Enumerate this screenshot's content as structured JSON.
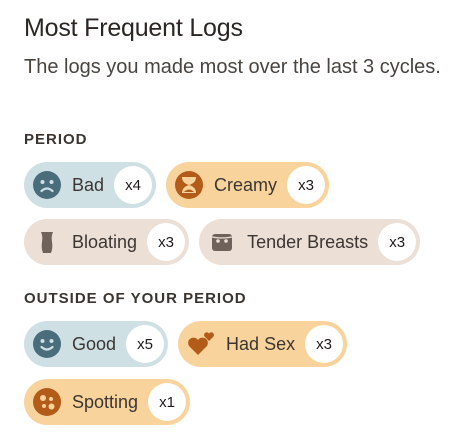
{
  "header": {
    "title": "Most Frequent Logs",
    "subtitle": "The logs you made most over the last 3 cycles."
  },
  "sections": [
    {
      "label": "PERIOD",
      "chips": [
        {
          "label": "Bad",
          "count": "x4",
          "color": "#cfe0e5",
          "icon": "sad-face-icon"
        },
        {
          "label": "Creamy",
          "count": "x3",
          "color": "#f9d39c",
          "icon": "creamy-discharge-icon"
        },
        {
          "label": "Bloating",
          "count": "x3",
          "color": "#ebdfd6",
          "icon": "bloating-icon"
        },
        {
          "label": "Tender Breasts",
          "count": "x3",
          "color": "#ebdfd6",
          "icon": "tender-breasts-icon"
        }
      ]
    },
    {
      "label": "OUTSIDE OF YOUR PERIOD",
      "chips": [
        {
          "label": "Good",
          "count": "x5",
          "color": "#cfe0e5",
          "icon": "happy-face-icon"
        },
        {
          "label": "Had Sex",
          "count": "x3",
          "color": "#f9d39c",
          "icon": "hearts-icon"
        },
        {
          "label": "Spotting",
          "count": "x1",
          "color": "#f9d39c",
          "icon": "spotting-icon"
        }
      ]
    }
  ]
}
